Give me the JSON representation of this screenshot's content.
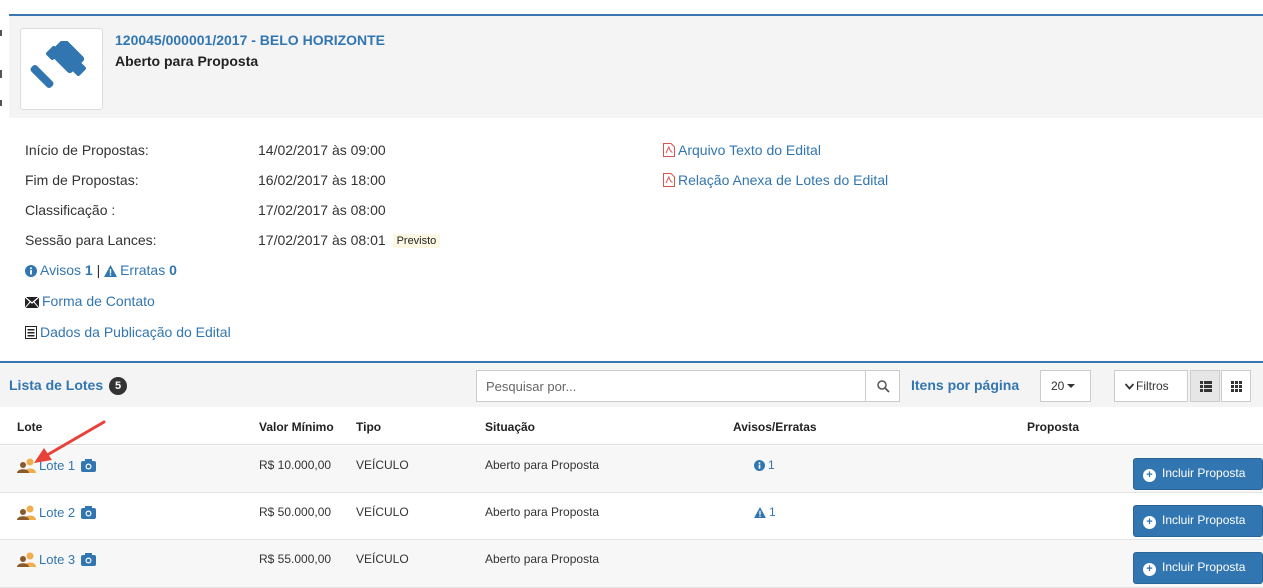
{
  "header": {
    "title": "120045/000001/2017 - BELO HORIZONTE",
    "subtitle": "Aberto para Proposta",
    "logo_icon": "gavel-icon"
  },
  "details": {
    "inicio_label": "Início de Propostas:",
    "inicio_value": "14/02/2017 às 09:00",
    "fim_label": "Fim de Propostas:",
    "fim_value": "16/02/2017 às 18:00",
    "classificacao_label": "Classificação :",
    "classificacao_value": "17/02/2017 às 08:00",
    "sessao_label": "Sessão para Lances:",
    "sessao_value": "17/02/2017 às 08:01",
    "sessao_badge": "Previsto",
    "avisos_label": "Avisos",
    "avisos_count": "1",
    "separator": "|",
    "erratas_label": "Erratas",
    "erratas_count": "0",
    "contato_label": "Forma de Contato",
    "publicacao_label": "Dados da Publicação do Edital",
    "arquivo_label": "Arquivo Texto do Edital",
    "relacao_label": "Relação Anexa de Lotes do Edital"
  },
  "list": {
    "title": "Lista de Lotes",
    "count": "5",
    "search_placeholder": "Pesquisar por...",
    "per_page_label": "Itens por página",
    "per_page_value": "20",
    "filtros_label": "Filtros",
    "columns": {
      "lote": "Lote",
      "valor": "Valor Mínimo",
      "tipo": "Tipo",
      "situacao": "Situação",
      "avisos": "Avisos/Erratas",
      "proposta": "Proposta"
    },
    "rows": [
      {
        "lote": "Lote 1",
        "valor": "R$ 10.000,00",
        "tipo": "VEÍCULO",
        "situacao": "Aberto para Proposta",
        "aviso_type": "info",
        "aviso_count": "1",
        "action": "Incluir Proposta"
      },
      {
        "lote": "Lote 2",
        "valor": "R$ 50.000,00",
        "tipo": "VEÍCULO",
        "situacao": "Aberto para Proposta",
        "aviso_type": "warning",
        "aviso_count": "1",
        "action": "Incluir Proposta"
      },
      {
        "lote": "Lote 3",
        "valor": "R$ 55.000,00",
        "tipo": "VEÍCULO",
        "situacao": "Aberto para Proposta",
        "aviso_type": "",
        "aviso_count": "",
        "action": "Incluir Proposta"
      }
    ]
  },
  "colors": {
    "primary": "#3276b1",
    "header_border": "#3c76b0",
    "pdf_red": "#d9534f",
    "annotation_arrow": "#e8413a"
  }
}
